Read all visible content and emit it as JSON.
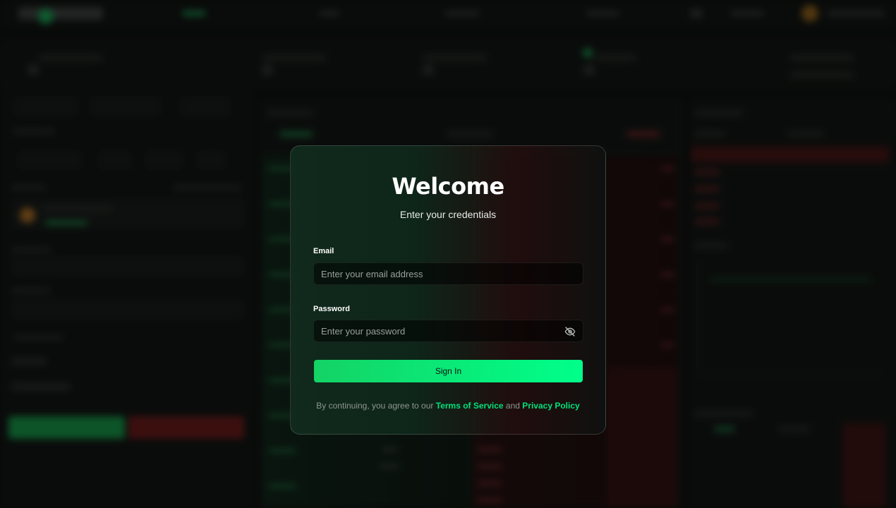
{
  "modal": {
    "title": "Welcome",
    "subtitle": "Enter your credentials",
    "email_label": "Email",
    "email_placeholder": "Enter your email address",
    "email_value": "",
    "password_label": "Password",
    "password_placeholder": "Enter your password",
    "password_value": "",
    "password_toggle_icon": "eye-off-icon",
    "signin_label": "Sign In",
    "terms_prefix": "By continuing, you agree to our",
    "terms_link": "Terms of Service",
    "terms_and": "and",
    "privacy_link": "Privacy Policy"
  },
  "colors": {
    "accent": "#00ff8a",
    "accent_dark": "#14d365",
    "link": "#00e27a",
    "page_background": "#0b0d0c"
  }
}
